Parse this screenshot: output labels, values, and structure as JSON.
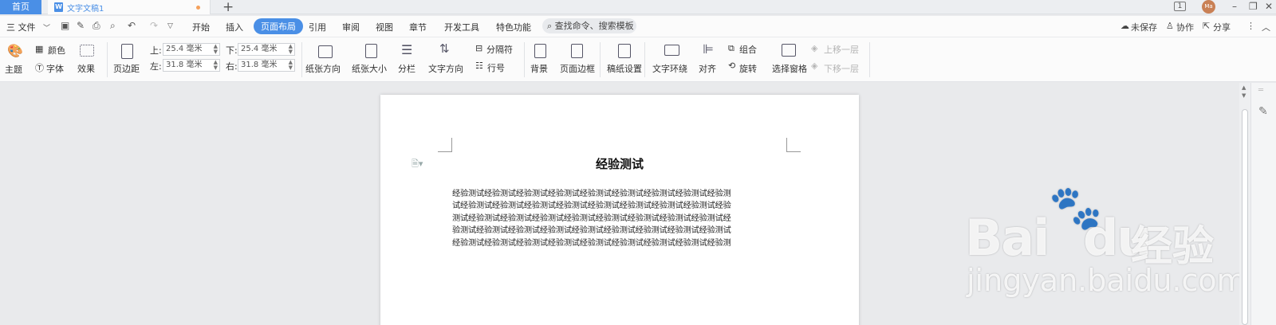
{
  "tabs": {
    "home_label": "首页",
    "doc_label": "文字文稿1",
    "add": "+",
    "page_indicator": "1",
    "avatar_text": "Ma"
  },
  "menu": {
    "file": "三 文件",
    "ribbon_tabs": [
      "开始",
      "插入",
      "页面布局",
      "引用",
      "审阅",
      "视图",
      "章节",
      "开发工具",
      "特色功能"
    ],
    "active_tab": "页面布局",
    "search": "查找命令、搜索模板",
    "actions": [
      "未保存",
      "协作",
      "分享"
    ]
  },
  "ribbon": {
    "theme": "主题",
    "color": "颜色",
    "font": "字体",
    "effect": "效果",
    "margins": "页边距",
    "margin_top_label": "上:",
    "margin_top": "25.4 毫米",
    "margin_bottom_label": "下:",
    "margin_bottom": "25.4 毫米",
    "margin_left_label": "左:",
    "margin_left": "31.8 毫米",
    "margin_right_label": "右:",
    "margin_right": "31.8 毫米",
    "orientation": "纸张方向",
    "size": "纸张大小",
    "columns": "分栏",
    "text_direction": "文字方向",
    "separator": "分隔符",
    "line_number": "行号",
    "background": "背景",
    "page_border": "页面边框",
    "manuscript": "稿纸设置",
    "wrap": "文字环绕",
    "align": "对齐",
    "group": "组合",
    "rotate": "旋转",
    "selection_pane": "选择窗格",
    "bring_forward": "上移一层",
    "send_backward": "下移一层"
  },
  "document": {
    "title": "经验测试",
    "lines": [
      "经验测试经验测试经验测试经验测试经验测试经验测试经验测试经验测试经验测",
      "试经验测试经验测试经验测试经验测试经验测试经验测试经验测试经验测试经验",
      "测试经验测试经验测试经验测试经验测试经验测试经验测试经验测试经验测试经",
      "验测试经验测试经验测试经验测试经验测试经验测试经验测试经验测试经验测试",
      "经验测试经验测试经验测试经验测试经验测试经验测试经验测试经验测试经验测"
    ]
  },
  "watermark": {
    "brand": "Bai",
    "brand2": "du",
    "cn": "经验",
    "url": "jingyan.baidu.com"
  }
}
